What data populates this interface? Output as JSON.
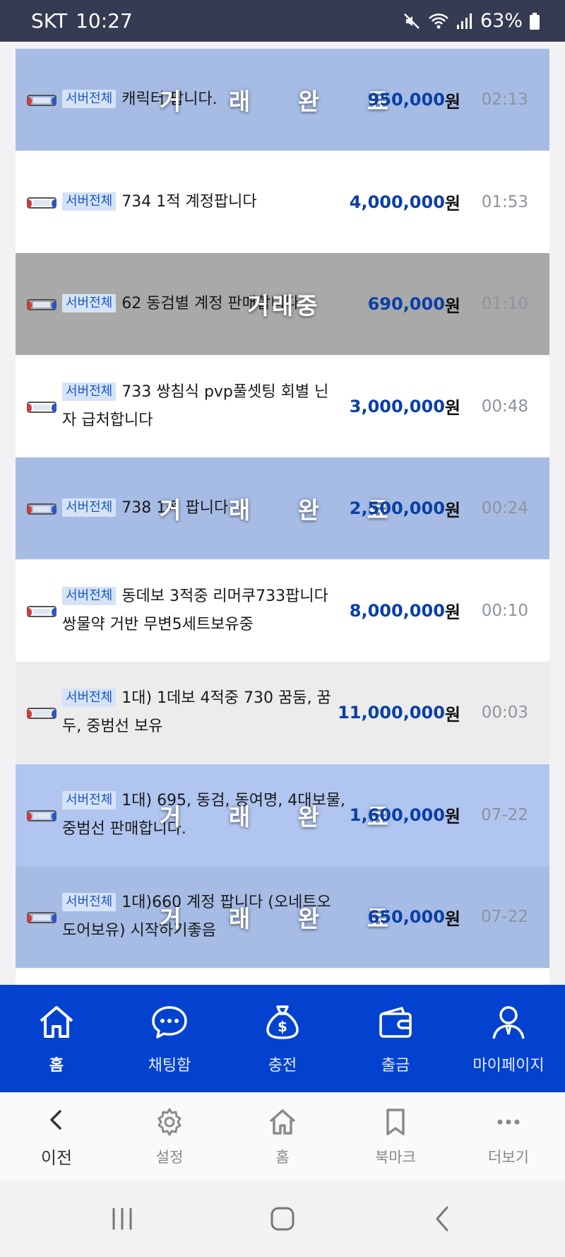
{
  "status_bar": {
    "carrier": "SKT",
    "time": "10:27",
    "battery": "63%"
  },
  "listings": [
    {
      "badge": "서버전체",
      "line1": "캐릭터 팝니다.",
      "line2": "",
      "price": "950,000",
      "currency": "원",
      "time": "02:13",
      "overlay": "거 래 완 료",
      "state": "blue"
    },
    {
      "badge": "서버전체",
      "line1": "734 1적 계정팝니다",
      "line2": "",
      "price": "4,000,000",
      "currency": "원",
      "time": "01:53",
      "overlay": "",
      "state": "white"
    },
    {
      "badge": "서버전체",
      "line1": "62 동검별 계정 판매합니다",
      "line2": "",
      "price": "690,000",
      "currency": "원",
      "time": "01:10",
      "overlay": "거래중",
      "state": "gray"
    },
    {
      "badge": "서버전체",
      "line1": "733 쌍침식 pvp풀셋팅 회별 닌",
      "line2": "자 급처합니다",
      "price": "3,000,000",
      "currency": "원",
      "time": "00:48",
      "overlay": "",
      "state": "white"
    },
    {
      "badge": "서버전체",
      "line1": "738 1적 팝니다~",
      "line2": "",
      "price": "2,500,000",
      "currency": "원",
      "time": "00:24",
      "overlay": "거 래 완 료",
      "state": "blue"
    },
    {
      "badge": "서버전체",
      "line1": "동데보 3적중 리머쿠733팝니다",
      "line2": "쌍물약 거반 무변5세트보유중",
      "price": "8,000,000",
      "currency": "원",
      "time": "00:10",
      "overlay": "",
      "state": "white"
    },
    {
      "badge": "서버전체",
      "line1": "1대) 1데보 4적중 730 꿈둠, 꿈",
      "line2": "두, 중범선 보유",
      "price": "11,000,000",
      "currency": "원",
      "time": "00:03",
      "overlay": "",
      "state": "light"
    },
    {
      "badge": "서버전체",
      "line1": "1대) 695, 동검, 동여명, 4대보물,",
      "line2": "중범선 판매합니다.",
      "price": "1,600,000",
      "currency": "원",
      "time": "07-22",
      "overlay": "거 래 완 료",
      "state": "blue2"
    },
    {
      "badge": "서버전체",
      "line1": "1대)660 계정 팝니다 (오네트오",
      "line2": "도어보유) 시작하기좋음",
      "price": "650,000",
      "currency": "원",
      "time": "07-22",
      "overlay": "거 래 완 료",
      "state": "blue"
    }
  ],
  "bottom_nav": {
    "items": [
      {
        "label": "홈",
        "icon": "home-icon"
      },
      {
        "label": "채팅함",
        "icon": "chat-icon"
      },
      {
        "label": "충전",
        "icon": "money-bag-icon"
      },
      {
        "label": "출금",
        "icon": "wallet-icon"
      },
      {
        "label": "마이페이지",
        "icon": "user-icon"
      }
    ]
  },
  "browser_bar": {
    "items": [
      {
        "label": "이전",
        "icon": "chevron-left-icon"
      },
      {
        "label": "설정",
        "icon": "gear-icon"
      },
      {
        "label": "홈",
        "icon": "home-outline-icon"
      },
      {
        "label": "북마크",
        "icon": "bookmark-icon"
      },
      {
        "label": "더보기",
        "icon": "more-icon"
      }
    ]
  }
}
